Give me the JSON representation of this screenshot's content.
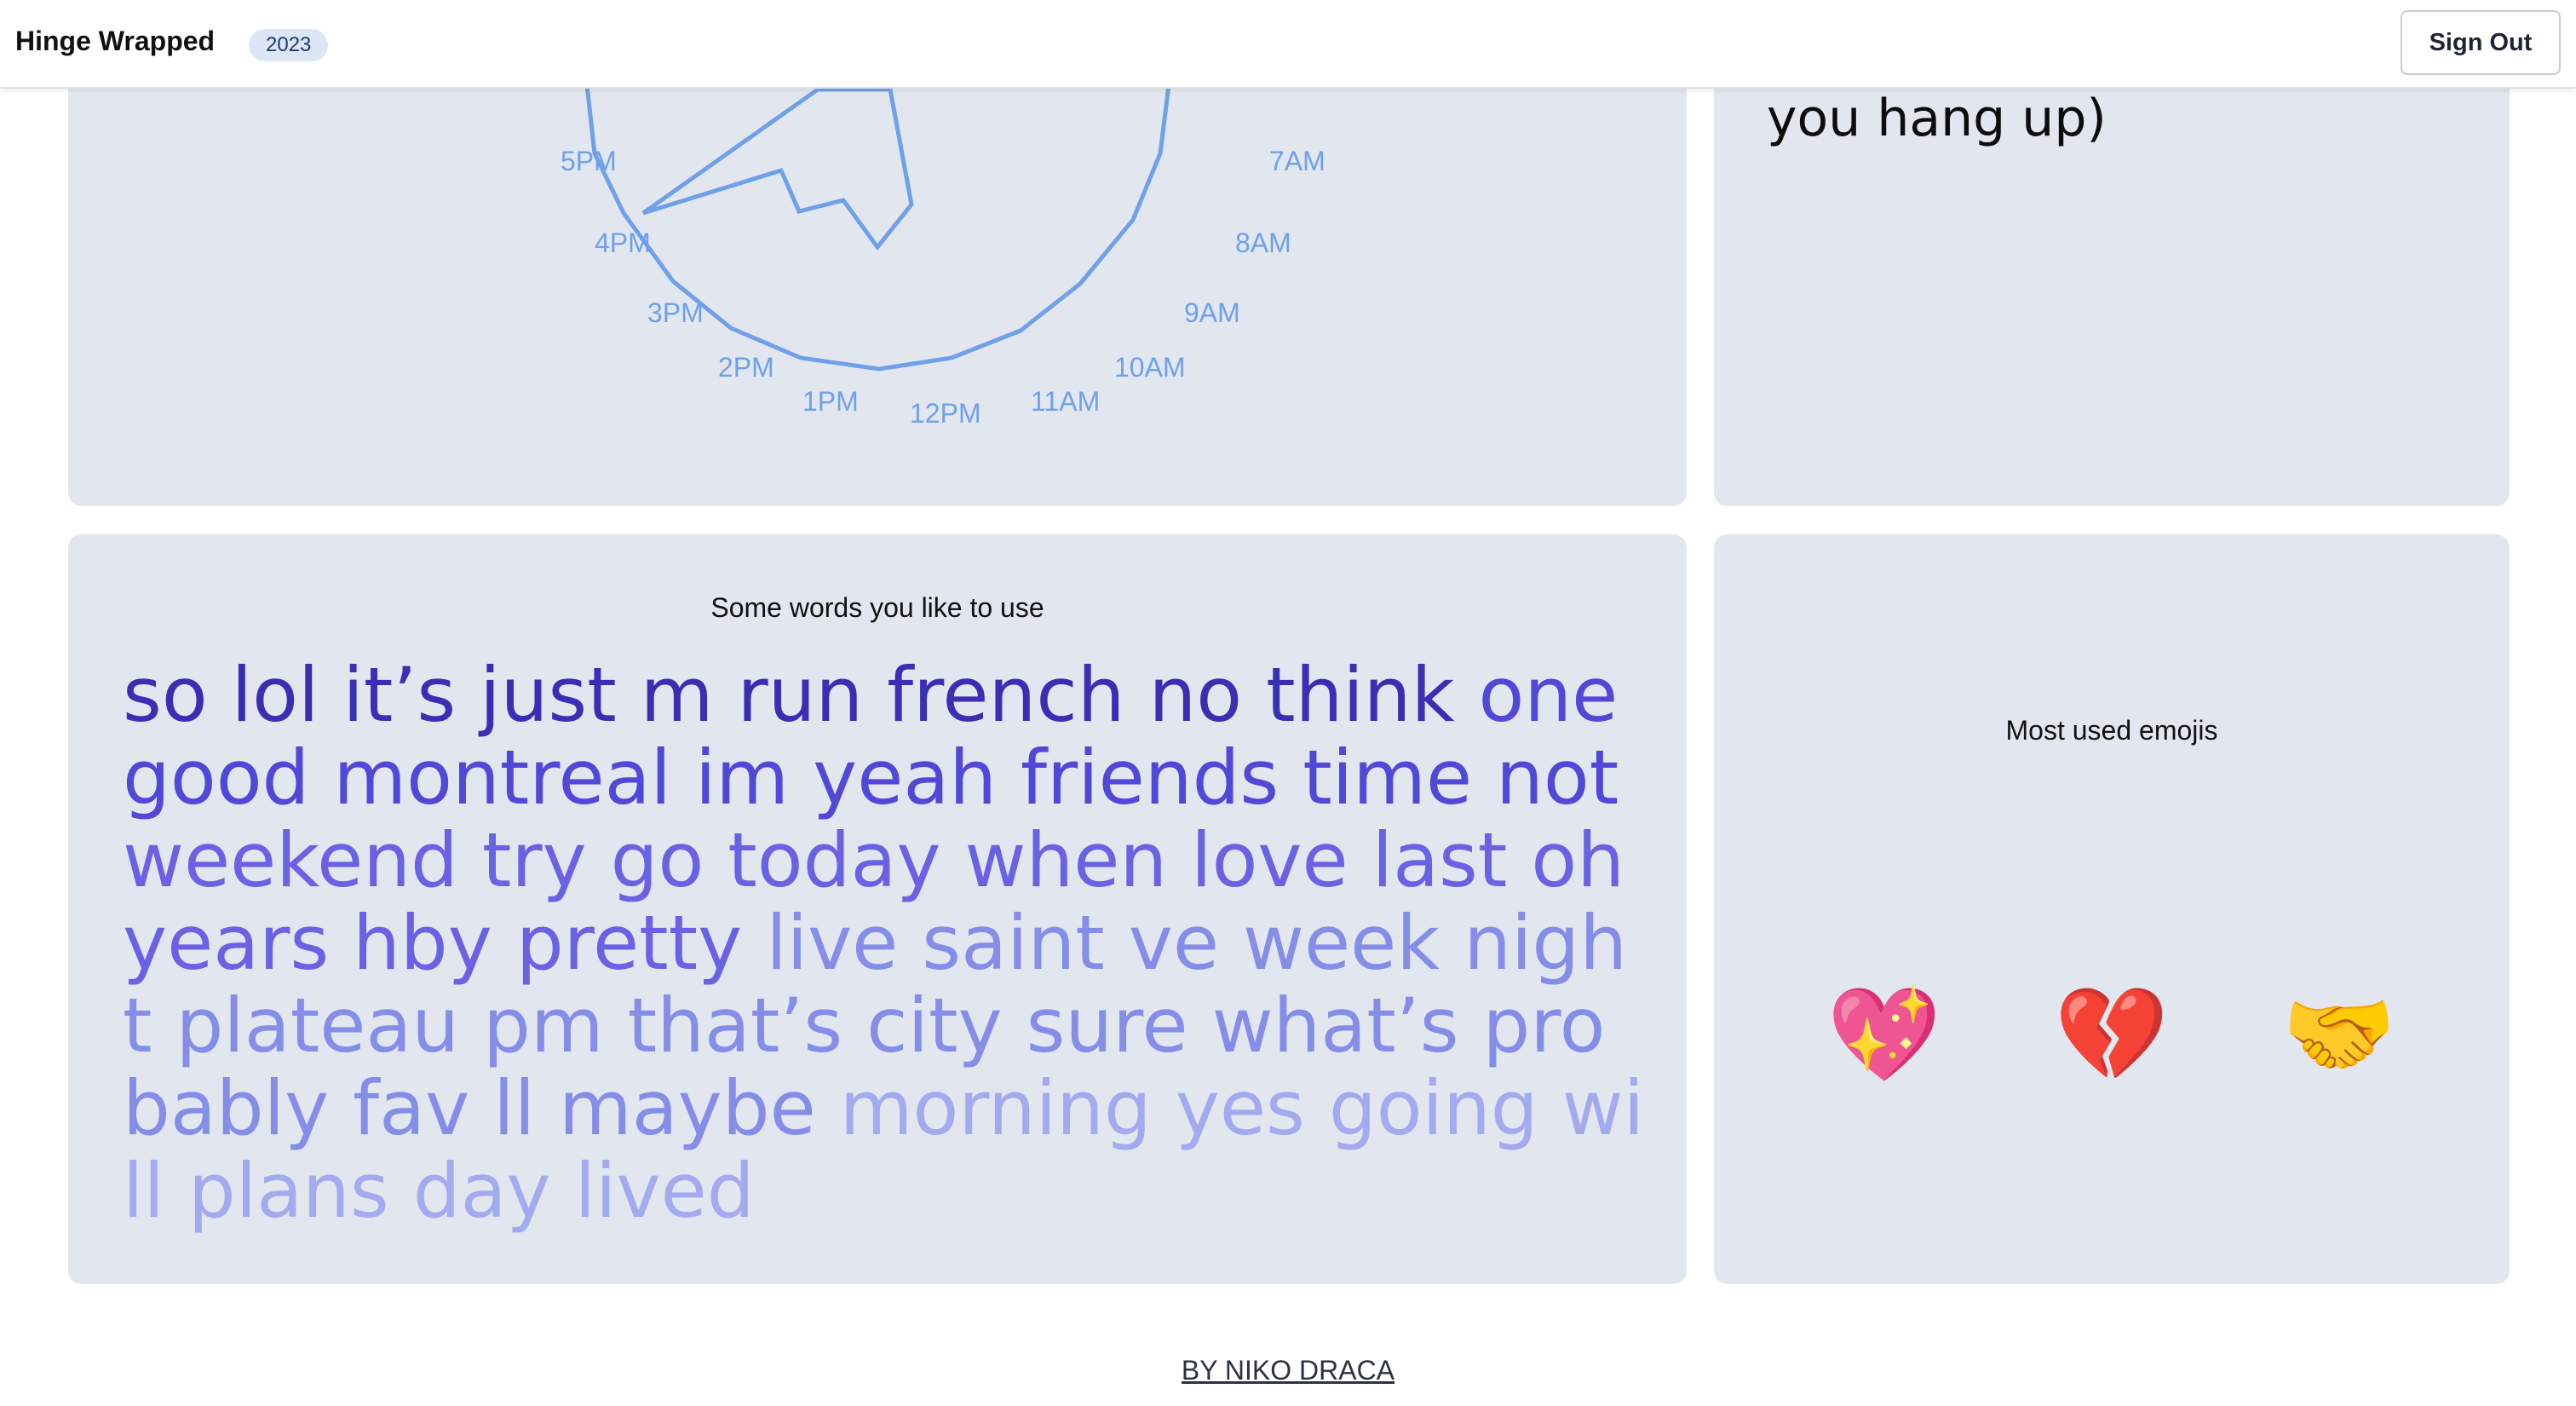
{
  "header": {
    "brand": "Hinge Wrapped",
    "year_badge": "2023",
    "sign_out_label": "Sign Out"
  },
  "clock_card": {
    "hour_labels": [
      "5PM",
      "4PM",
      "3PM",
      "2PM",
      "1PM",
      "12PM",
      "11AM",
      "10AM",
      "9AM",
      "8AM",
      "7AM"
    ],
    "line_color": "#6ea1ea"
  },
  "side_card": {
    "text": "you hang up)"
  },
  "words_card": {
    "title": "Some words you like to use",
    "words": [
      {
        "text": "so",
        "tier": 1
      },
      {
        "text": "lol",
        "tier": 1
      },
      {
        "text": "it’s",
        "tier": 1
      },
      {
        "text": "just",
        "tier": 1
      },
      {
        "text": "m",
        "tier": 1
      },
      {
        "text": "run",
        "tier": 1
      },
      {
        "text": "french",
        "tier": 1
      },
      {
        "text": "no",
        "tier": 1
      },
      {
        "text": "think",
        "tier": 1
      },
      {
        "text": "one",
        "tier": 2
      },
      {
        "text": "good",
        "tier": 2
      },
      {
        "text": "montreal",
        "tier": 2
      },
      {
        "text": "im",
        "tier": 2
      },
      {
        "text": "yeah",
        "tier": 2
      },
      {
        "text": "friends",
        "tier": 2
      },
      {
        "text": "time",
        "tier": 2
      },
      {
        "text": "not",
        "tier": 2
      },
      {
        "text": "weekend",
        "tier": 3
      },
      {
        "text": "try",
        "tier": 3
      },
      {
        "text": "go",
        "tier": 3
      },
      {
        "text": "today",
        "tier": 3
      },
      {
        "text": "when",
        "tier": 3
      },
      {
        "text": "love",
        "tier": 3
      },
      {
        "text": "last",
        "tier": 3
      },
      {
        "text": "oh",
        "tier": 3
      },
      {
        "text": "years",
        "tier": 3
      },
      {
        "text": "hby",
        "tier": 3
      },
      {
        "text": "pretty",
        "tier": 3
      },
      {
        "text": "live",
        "tier": 4
      },
      {
        "text": "saint",
        "tier": 4
      },
      {
        "text": "ve",
        "tier": 4
      },
      {
        "text": "week",
        "tier": 4
      },
      {
        "text": "night",
        "tier": 4
      },
      {
        "text": "plateau",
        "tier": 4
      },
      {
        "text": "pm",
        "tier": 4
      },
      {
        "text": "that’s",
        "tier": 4
      },
      {
        "text": "city",
        "tier": 4
      },
      {
        "text": "sure",
        "tier": 4
      },
      {
        "text": "what’s",
        "tier": 4
      },
      {
        "text": "probably",
        "tier": 4
      },
      {
        "text": "fav",
        "tier": 4
      },
      {
        "text": "ll",
        "tier": 4
      },
      {
        "text": "maybe",
        "tier": 4
      },
      {
        "text": "morning",
        "tier": 5
      },
      {
        "text": "yes",
        "tier": 5
      },
      {
        "text": "going",
        "tier": 5
      },
      {
        "text": "will",
        "tier": 5
      },
      {
        "text": "plans",
        "tier": 5
      },
      {
        "text": "day",
        "tier": 5
      },
      {
        "text": "lived",
        "tier": 5
      }
    ]
  },
  "emoji_card": {
    "title": "Most used emojis",
    "emojis": [
      "💖",
      "💔",
      "🤝"
    ]
  },
  "footer": {
    "link_text": "BY NIKO DRACA"
  }
}
